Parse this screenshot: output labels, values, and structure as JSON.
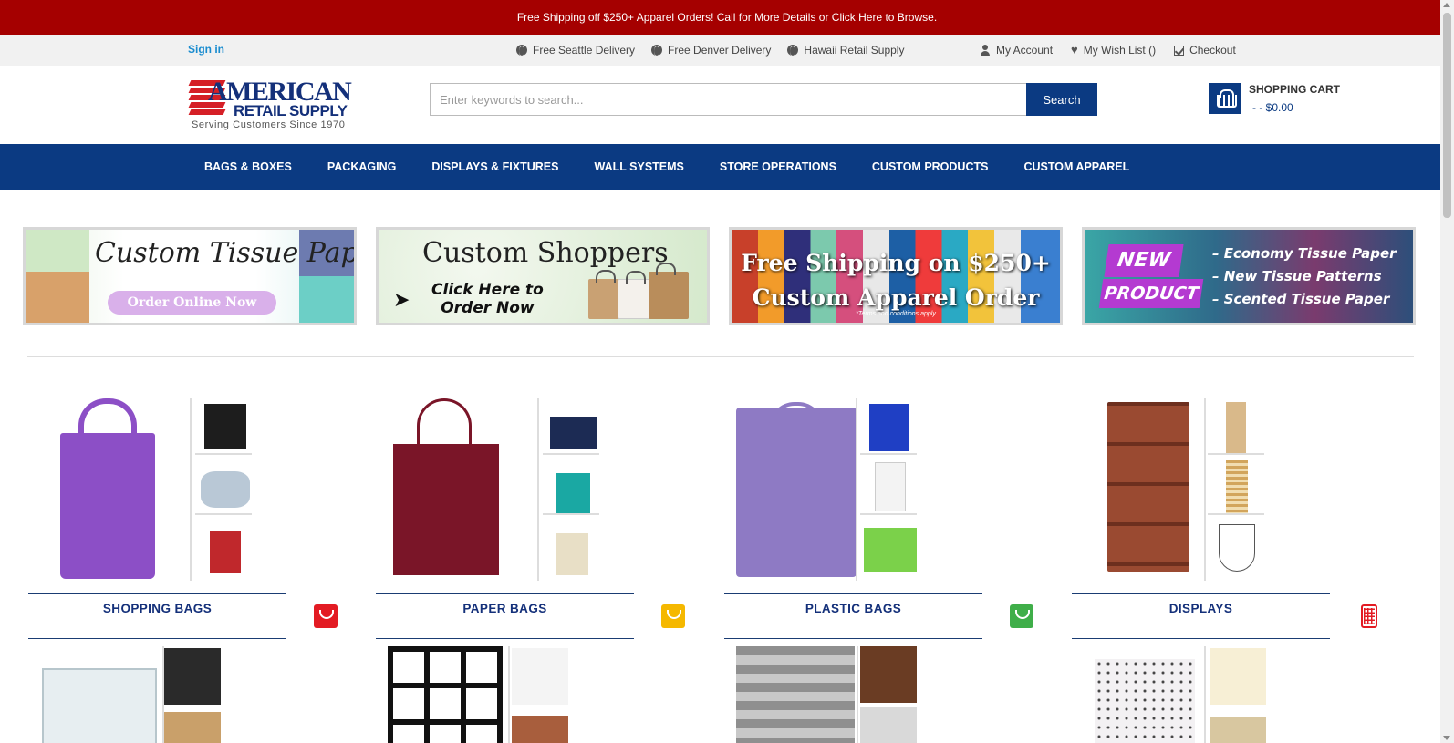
{
  "promo": {
    "text": "Free Shipping off $250+ Apparel Orders! Call for More Details or Click Here to Browse."
  },
  "util": {
    "sign_in": "Sign in",
    "delivery": [
      "Free Seattle Delivery",
      "Free Denver Delivery",
      "Hawaii Retail Supply"
    ],
    "my_account": "My Account",
    "wish_list": "My Wish List ()",
    "checkout": "Checkout"
  },
  "logo": {
    "main": "AMERICAN",
    "sub": "RETAIL SUPPLY",
    "tagline": "Serving Customers Since 1970",
    "colors": {
      "red": "#d51f26",
      "blue": "#14307a"
    }
  },
  "search": {
    "placeholder": "Enter keywords to search...",
    "button": "Search"
  },
  "cart": {
    "title": "SHOPPING CART",
    "summary": "-   -  $0.00"
  },
  "nav": [
    "BAGS & BOXES",
    "PACKAGING",
    "DISPLAYS & FIXTURES",
    "WALL SYSTEMS",
    "STORE OPERATIONS",
    "CUSTOM PRODUCTS",
    "CUSTOM APPAREL"
  ],
  "banners": {
    "tissue": {
      "title": "Custom Tissue Paper",
      "button": "Order Online Now"
    },
    "shoppers": {
      "title": "Custom Shoppers",
      "sub1": "Click Here to",
      "sub2": "Order Now"
    },
    "apparel": {
      "line1": "Free Shipping on $250+",
      "line2": "Custom Apparel Order",
      "terms": "*Terms and conditions apply"
    },
    "new_product": {
      "badge1": "NEW",
      "badge2": "PRODUCT",
      "items": [
        "– Economy Tissue Paper",
        "– New Tissue Patterns",
        "– Scented Tissue Paper"
      ]
    }
  },
  "categories": [
    {
      "title": "SHOPPING BAGS",
      "icon_color": "#e31b23"
    },
    {
      "title": "PAPER BAGS",
      "icon_color": "#f5b800"
    },
    {
      "title": "PLASTIC BAGS",
      "icon_color": "#3fae49"
    },
    {
      "title": "DISPLAYS",
      "icon_color": "#e31b23"
    }
  ],
  "colors": {
    "promo_bg": "#a50000",
    "nav_bg": "#0b3a82",
    "accent_link": "#1a8ccf"
  }
}
